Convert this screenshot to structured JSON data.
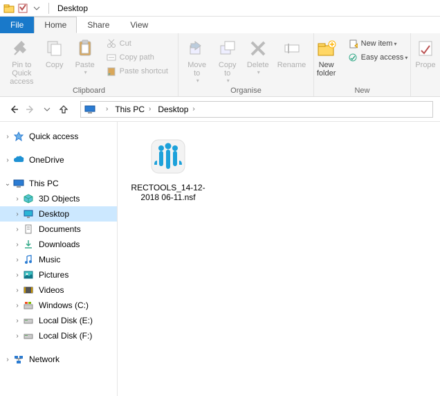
{
  "titlebar": {
    "title": "Desktop"
  },
  "tabs": {
    "file": "File",
    "home": "Home",
    "share": "Share",
    "view": "View"
  },
  "ribbon": {
    "clipboard": {
      "label": "Clipboard",
      "pin": "Pin to Quick\naccess",
      "copy": "Copy",
      "paste": "Paste",
      "cut": "Cut",
      "copypath": "Copy path",
      "shortcut": "Paste shortcut"
    },
    "organise": {
      "label": "Organise",
      "moveto": "Move\nto",
      "copyto": "Copy\nto",
      "delete": "Delete",
      "rename": "Rename"
    },
    "new": {
      "label": "New",
      "newfolder": "New\nfolder",
      "newitem": "New item",
      "easyaccess": "Easy access"
    },
    "open": {
      "properties": "Prope"
    }
  },
  "breadcrumb": {
    "pc": "This PC",
    "loc": "Desktop"
  },
  "sidebar": {
    "quick": "Quick access",
    "onedrive": "OneDrive",
    "thispc": "This PC",
    "objects3d": "3D Objects",
    "desktop": "Desktop",
    "documents": "Documents",
    "downloads": "Downloads",
    "music": "Music",
    "pictures": "Pictures",
    "videos": "Videos",
    "cdrive": "Windows (C:)",
    "edrive": "Local Disk (E:)",
    "fdrive": "Local Disk (F:)",
    "network": "Network"
  },
  "files": {
    "item1": "RECTOOLS_14-12-2018 06-11.nsf"
  }
}
